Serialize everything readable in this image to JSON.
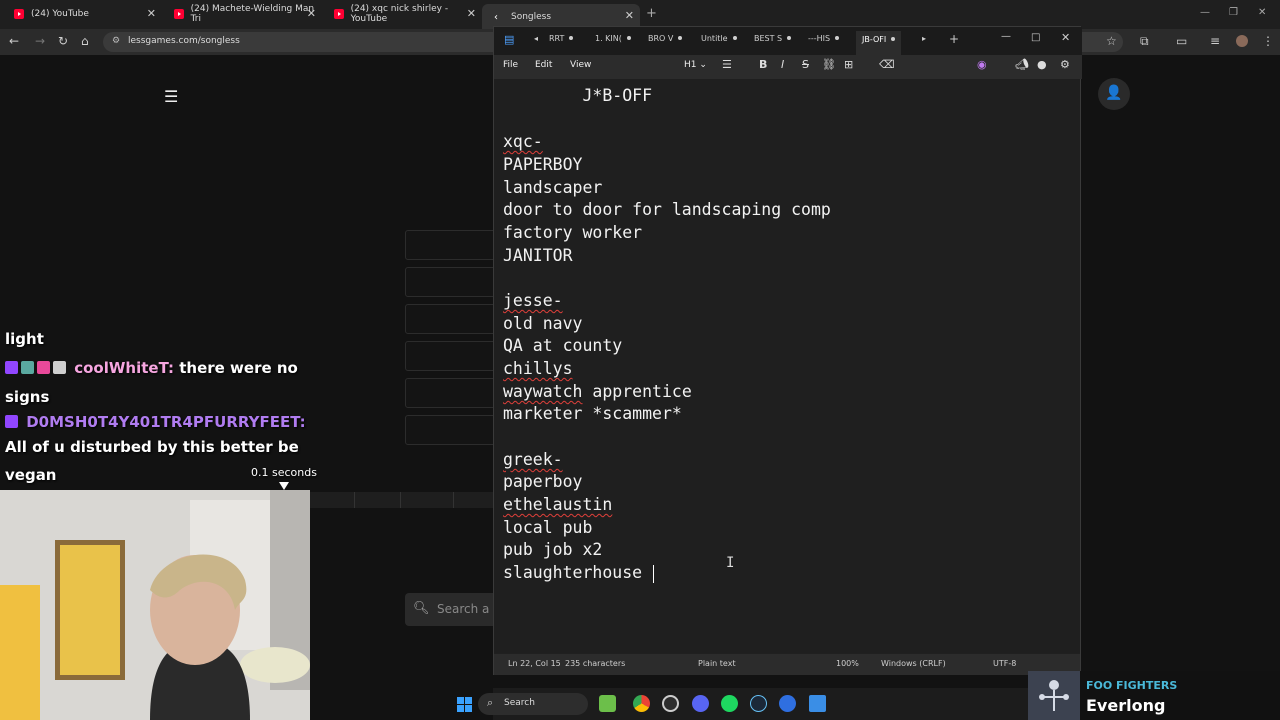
{
  "browser": {
    "tabs": [
      {
        "label": "(24) YouTube"
      },
      {
        "label": "(24) Machete-Wielding Man Tri"
      },
      {
        "label": "(24) xqc nick shirley - YouTube"
      },
      {
        "label": "Songless"
      }
    ],
    "url": "lessgames.com/songless"
  },
  "page": {
    "search_placeholder": "Search a"
  },
  "chat": {
    "lines": [
      {
        "text": "light"
      },
      {
        "user": "coolWhiteT:",
        "text": "there were no",
        "user_color": "#f6a6e0"
      },
      {
        "text": "signs"
      },
      {
        "user": "D0MSH0T4Y401TR4PFURRYFEET:",
        "user_color": "#b07cf0"
      },
      {
        "text": "All of u disturbed by this better be"
      },
      {
        "text": "vegan"
      }
    ],
    "duration": "0.1 seconds"
  },
  "notepad": {
    "tabs": [
      "RRT",
      "1. KIN(",
      "BRO V",
      "Untitle",
      "BEST S",
      "---HIS",
      "JB-OFI"
    ],
    "menu": {
      "file": "File",
      "edit": "Edit",
      "view": "View",
      "heading": "H1"
    },
    "lines": [
      {
        "text": "        J*B-OFF"
      },
      {
        "text": ""
      },
      {
        "text": "xqc-",
        "spell": true
      },
      {
        "text": "PAPERBOY"
      },
      {
        "text": "landscaper"
      },
      {
        "text": "door to door for landscaping comp"
      },
      {
        "text": "factory worker"
      },
      {
        "text": "JANITOR"
      },
      {
        "text": ""
      },
      {
        "text": "jesse-",
        "spell": true
      },
      {
        "text": "old navy"
      },
      {
        "text": "QA at county"
      },
      {
        "text": "chillys",
        "spell": true
      },
      {
        "text": "waywatch",
        "rest": " apprentice",
        "spell": true
      },
      {
        "text": "marketer *scammer*"
      },
      {
        "text": ""
      },
      {
        "text": "greek-",
        "spell": true
      },
      {
        "text": "paperboy"
      },
      {
        "text": "ethelaustin",
        "spell": true
      },
      {
        "text": "local pub"
      },
      {
        "text": "pub job x2"
      },
      {
        "text": "slaughterhouse"
      }
    ],
    "status": {
      "position": "Ln 22, Col 15",
      "chars": "235 characters",
      "format": "Plain text",
      "zoom": "100%",
      "line_ending": "Windows (CRLF)",
      "encoding": "UTF-8"
    }
  },
  "taskbar": {
    "search_label": "Search"
  },
  "now_playing": {
    "artist": "FOO FIGHTERS",
    "song": "Everlong"
  }
}
